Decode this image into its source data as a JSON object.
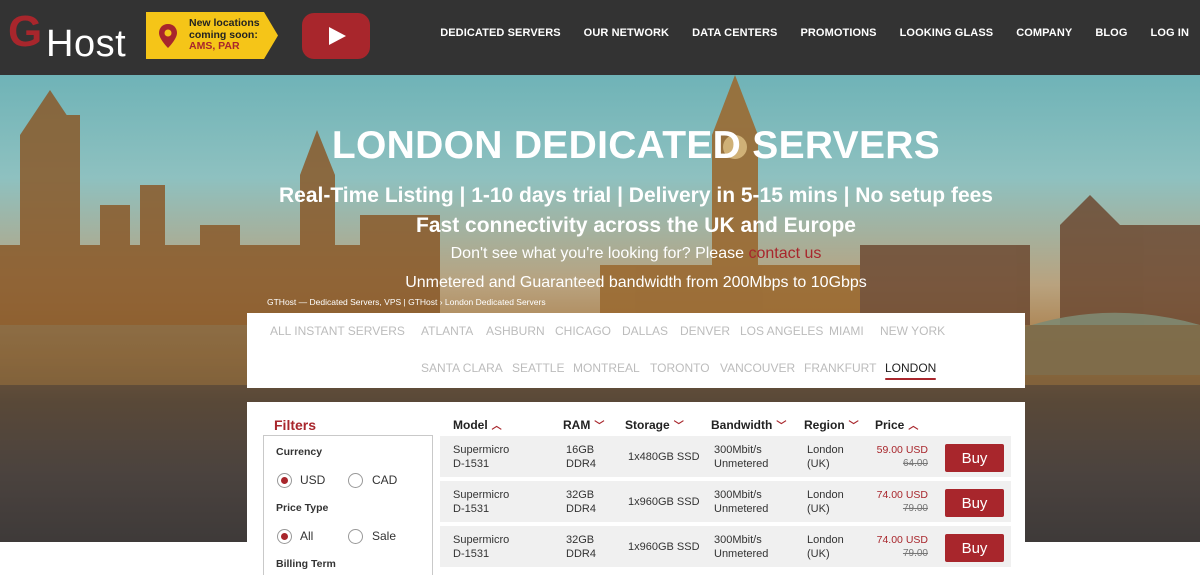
{
  "header": {
    "logo_letter": "G",
    "logo_text": "Host",
    "promo": {
      "line1": "New locations",
      "line2": "coming soon:",
      "line3": "AMS, PAR"
    },
    "nav": [
      "DEDICATED SERVERS",
      "OUR NETWORK",
      "DATA CENTERS",
      "PROMOTIONS",
      "LOOKING GLASS",
      "COMPANY",
      "BLOG",
      "LOG IN"
    ]
  },
  "hero": {
    "title": "LONDON DEDICATED SERVERS",
    "subtitle1": "Real-Time Listing | 1-10 days trial | Delivery in 5-15 mins | No setup fees",
    "subtitle2": "Fast connectivity across the UK and Europe",
    "contact_prefix": "Don't see what you're looking for? Please ",
    "contact_link": "contact us",
    "bandwidth": "Unmetered and Guaranteed bandwidth from 200Mbps to 10Gbps",
    "breadcrumb": "GTHost — Dedicated Servers, VPS | GTHost › London Dedicated Servers"
  },
  "cities": {
    "all": "ALL INSTANT SERVERS",
    "row1": [
      "ATLANTA",
      "ASHBURN",
      "CHICAGO",
      "DALLAS",
      "DENVER",
      "LOS ANGELES",
      "MIAMI",
      "NEW YORK"
    ],
    "row2": [
      "SANTA CLARA",
      "SEATTLE",
      "MONTREAL",
      "TORONTO",
      "VANCOUVER",
      "FRANKFURT",
      "LONDON"
    ],
    "active": "LONDON"
  },
  "filters": {
    "title": "Filters",
    "currency_label": "Currency",
    "currency_options": [
      "USD",
      "CAD"
    ],
    "currency_selected": "USD",
    "price_type_label": "Price Type",
    "price_type_options": [
      "All",
      "Sale"
    ],
    "price_type_selected": "All",
    "billing_label": "Billing Term"
  },
  "table": {
    "columns": [
      "Model",
      "RAM",
      "Storage",
      "Bandwidth",
      "Region",
      "Price"
    ],
    "rows": [
      {
        "model1": "Supermicro",
        "model2": "D-1531",
        "ram1": "16GB",
        "ram2": "DDR4",
        "storage": "1x480GB SSD",
        "bw1": "300Mbit/s",
        "bw2": "Unmetered",
        "region1": "London",
        "region2": "(UK)",
        "price": "59.00 USD",
        "old_price": "64.00",
        "buy": "Buy"
      },
      {
        "model1": "Supermicro",
        "model2": "D-1531",
        "ram1": "32GB",
        "ram2": "DDR4",
        "storage": "1x960GB SSD",
        "bw1": "300Mbit/s",
        "bw2": "Unmetered",
        "region1": "London",
        "region2": "(UK)",
        "price": "74.00 USD",
        "old_price": "79.00",
        "buy": "Buy"
      },
      {
        "model1": "Supermicro",
        "model2": "D-1531",
        "ram1": "32GB",
        "ram2": "DDR4",
        "storage": "1x960GB SSD",
        "bw1": "300Mbit/s",
        "bw2": "Unmetered",
        "region1": "London",
        "region2": "(UK)",
        "price": "74.00 USD",
        "old_price": "79.00",
        "buy": "Buy"
      }
    ]
  },
  "colors": {
    "brand": "#a8262c",
    "header_bg": "#333333",
    "promo_bg": "#f5c518"
  },
  "icons": {
    "promo": "map-pin-icon",
    "video": "youtube-play-icon",
    "sort_up": "chevron-up-icon",
    "sort_down": "chevron-down-icon"
  }
}
